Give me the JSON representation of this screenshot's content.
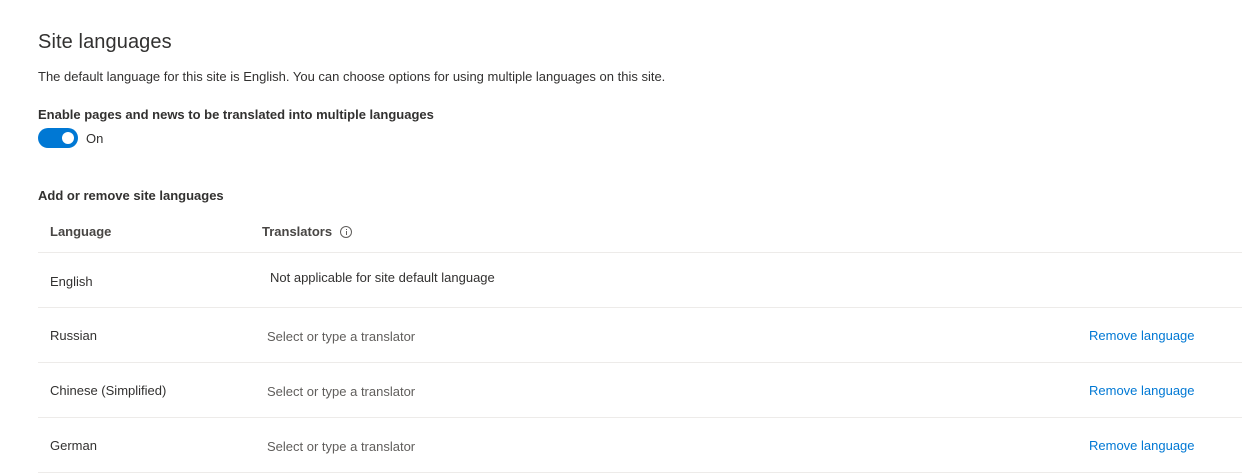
{
  "header": {
    "title": "Site languages",
    "description": "The default language for this site is English. You can choose options for using multiple languages on this site."
  },
  "translation_toggle": {
    "label": "Enable pages and news to be translated into multiple languages",
    "state_label": "On",
    "enabled": true
  },
  "languages_section": {
    "label": "Add or remove site languages",
    "columns": {
      "language": "Language",
      "translators": "Translators"
    },
    "rows": [
      {
        "language": "English",
        "translator_text": "Not applicable for site default language"
      },
      {
        "language": "Russian",
        "translator_placeholder": "Select or type a translator",
        "remove_label": "Remove language"
      },
      {
        "language": "Chinese (Simplified)",
        "translator_placeholder": "Select or type a translator",
        "remove_label": "Remove language"
      },
      {
        "language": "German",
        "translator_placeholder": "Select or type a translator",
        "remove_label": "Remove language"
      }
    ]
  },
  "colors": {
    "accent": "#0078d4",
    "text": "#323130",
    "divider": "#edebe9"
  },
  "icons": {
    "info": "info-icon"
  }
}
